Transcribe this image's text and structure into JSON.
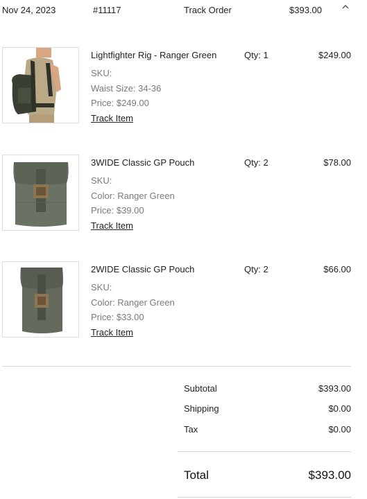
{
  "order_header": {
    "date": "Nov 24, 2023",
    "order_number": "#11117",
    "track_label": "Track Order",
    "total": "$393.00",
    "toggle_icon": "chevron-up-icon"
  },
  "items": [
    {
      "name": "Lightfighter Rig - Ranger Green",
      "qty": "Qty: 1",
      "price": "$249.00",
      "sku": "SKU:",
      "variant": "Waist Size: 34-36",
      "unit_price": "Price: $249.00",
      "track_label": "Track Item",
      "image": "lightfighter-rig-photo"
    },
    {
      "name": "3WIDE Classic GP Pouch",
      "qty": "Qty: 2",
      "price": "$78.00",
      "sku": "SKU:",
      "variant": "Color: Ranger Green",
      "unit_price": "Price: $39.00",
      "track_label": "Track Item",
      "image": "3wide-pouch-photo"
    },
    {
      "name": "2WIDE Classic GP Pouch",
      "qty": "Qty: 2",
      "price": "$66.00",
      "sku": "SKU:",
      "variant": "Color: Ranger Green",
      "unit_price": "Price: $33.00",
      "track_label": "Track Item",
      "image": "2wide-pouch-photo"
    }
  ],
  "summary": {
    "subtotal_label": "Subtotal",
    "subtotal_value": "$393.00",
    "shipping_label": "Shipping",
    "shipping_value": "$0.00",
    "tax_label": "Tax",
    "tax_value": "$0.00",
    "total_label": "Total",
    "total_value": "$393.00"
  },
  "colors": {
    "text": "#222222",
    "muted": "#7a7a7a",
    "divider": "#d8d8d8",
    "ranger_green": "#5f6a58"
  }
}
